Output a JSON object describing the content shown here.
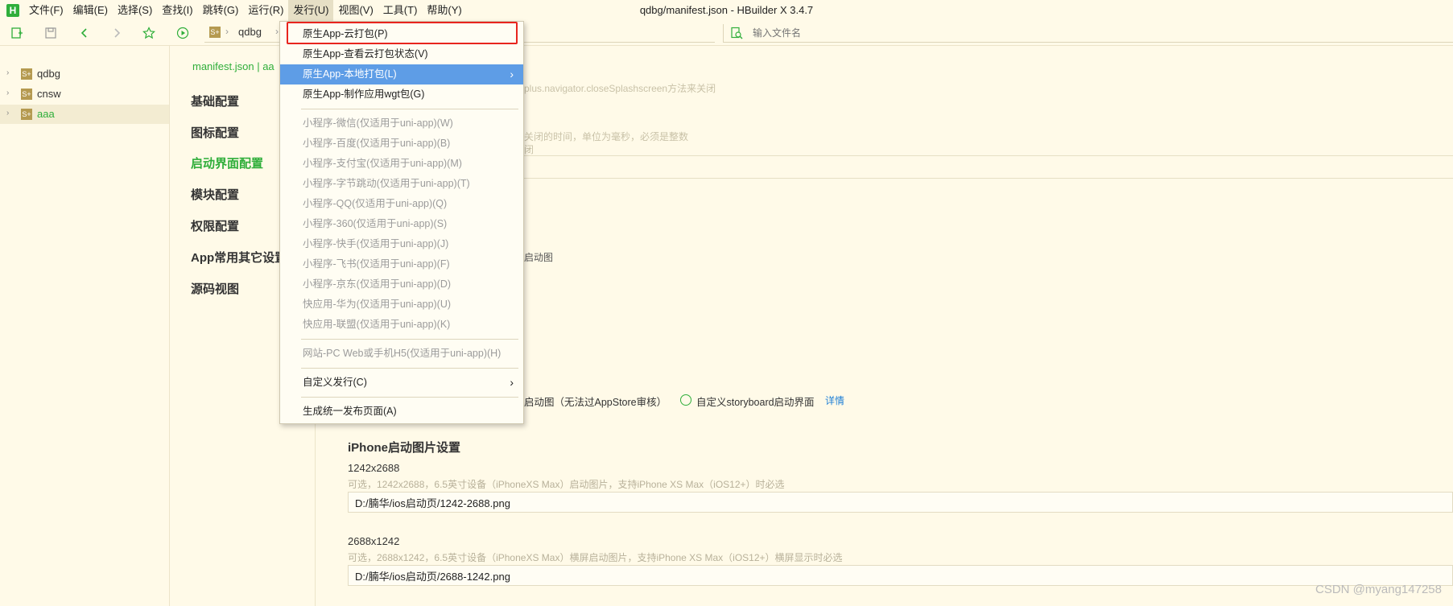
{
  "window": {
    "title": "qdbg/manifest.json - HBuilder X 3.4.7",
    "logo": "H"
  },
  "menubar": {
    "items": [
      {
        "label": "文件(F)"
      },
      {
        "label": "编辑(E)"
      },
      {
        "label": "选择(S)"
      },
      {
        "label": "查找(I)"
      },
      {
        "label": "跳转(G)"
      },
      {
        "label": "运行(R)"
      },
      {
        "label": "发行(U)",
        "active": true
      },
      {
        "label": "视图(V)"
      },
      {
        "label": "工具(T)"
      },
      {
        "label": "帮助(Y)"
      }
    ]
  },
  "toolbar": {
    "icons": [
      "new-file-icon",
      "save-icon",
      "back-icon",
      "forward-icon",
      "star-icon",
      "run-icon"
    ],
    "breadcrumb": {
      "project_icon": "S+",
      "label": "qdbg"
    },
    "file_search_placeholder": "输入文件名"
  },
  "sidebar": {
    "projects": [
      {
        "label": "qdbg",
        "icon": "S+",
        "selected": false
      },
      {
        "label": "cnsw",
        "icon": "S+",
        "selected": false
      },
      {
        "label": "aaa",
        "icon": "S+",
        "selected": true
      }
    ]
  },
  "content": {
    "tab_path": "manifest.json | aa",
    "nav": [
      {
        "label": "基础配置",
        "active": false
      },
      {
        "label": "图标配置",
        "active": false
      },
      {
        "label": "启动界面配置",
        "active": true
      },
      {
        "label": "模块配置",
        "active": false
      },
      {
        "label": "权限配置",
        "active": false
      },
      {
        "label": "App常用其它设置",
        "active": false
      },
      {
        "label": "源码视图",
        "active": false
      }
    ],
    "faint_texts": {
      "close_splash_hint": "用plus.navigator.closeSplashscreen方法来关闭",
      "close_time_hint": "关闭的时间，单位为毫秒，必须是整数",
      "close_hint_short": "闭",
      "splash_image": "启动图"
    },
    "ios_options": {
      "option1": "启动图（无法过AppStore审核）",
      "option2": "自定义storyboard启动界面",
      "details_link": "详情"
    },
    "iphone_section": {
      "title": "iPhone启动图片设置",
      "items": [
        {
          "size": "1242x2688",
          "desc": "可选，1242x2688，6.5英寸设备（iPhoneXS Max）启动图片，支持iPhone XS Max（iOS12+）时必选",
          "path": "D:/腩华/ios启动页/1242-2688.png"
        },
        {
          "size": "2688x1242",
          "desc": "可选，2688x1242，6.5英寸设备（iPhoneXS Max）横屏启动图片，支持iPhone XS Max（iOS12+）横屏显示时必选",
          "path": "D:/腩华/ios启动页/2688-1242.png"
        }
      ]
    }
  },
  "dropdown": {
    "items": [
      {
        "label": "原生App-云打包(P)",
        "type": "item",
        "highlighted": true
      },
      {
        "label": "原生App-查看云打包状态(V)",
        "type": "item"
      },
      {
        "label": "原生App-本地打包(L)",
        "type": "submenu",
        "hover": true
      },
      {
        "label": "原生App-制作应用wgt包(G)",
        "type": "item"
      },
      {
        "type": "separator"
      },
      {
        "label": "小程序-微信(仅适用于uni-app)(W)",
        "type": "disabled"
      },
      {
        "label": "小程序-百度(仅适用于uni-app)(B)",
        "type": "disabled"
      },
      {
        "label": "小程序-支付宝(仅适用于uni-app)(M)",
        "type": "disabled"
      },
      {
        "label": "小程序-字节跳动(仅适用于uni-app)(T)",
        "type": "disabled"
      },
      {
        "label": "小程序-QQ(仅适用于uni-app)(Q)",
        "type": "disabled"
      },
      {
        "label": "小程序-360(仅适用于uni-app)(S)",
        "type": "disabled"
      },
      {
        "label": "小程序-快手(仅适用于uni-app)(J)",
        "type": "disabled"
      },
      {
        "label": "小程序-飞书(仅适用于uni-app)(F)",
        "type": "disabled"
      },
      {
        "label": "小程序-京东(仅适用于uni-app)(D)",
        "type": "disabled"
      },
      {
        "label": "快应用-华为(仅适用于uni-app)(U)",
        "type": "disabled"
      },
      {
        "label": "快应用-联盟(仅适用于uni-app)(K)",
        "type": "disabled"
      },
      {
        "type": "separator"
      },
      {
        "label": "网站-PC Web或手机H5(仅适用于uni-app)(H)",
        "type": "disabled"
      },
      {
        "type": "separator"
      },
      {
        "label": "自定义发行(C)",
        "type": "submenu"
      },
      {
        "type": "separator"
      },
      {
        "label": "生成统一发布页面(A)",
        "type": "item"
      }
    ]
  },
  "watermark": "CSDN @myang147258",
  "colors": {
    "accent": "#2fae3a",
    "highlight_box": "#e8251e",
    "menu_hover": "#5e9de6",
    "background": "#fffae8"
  }
}
